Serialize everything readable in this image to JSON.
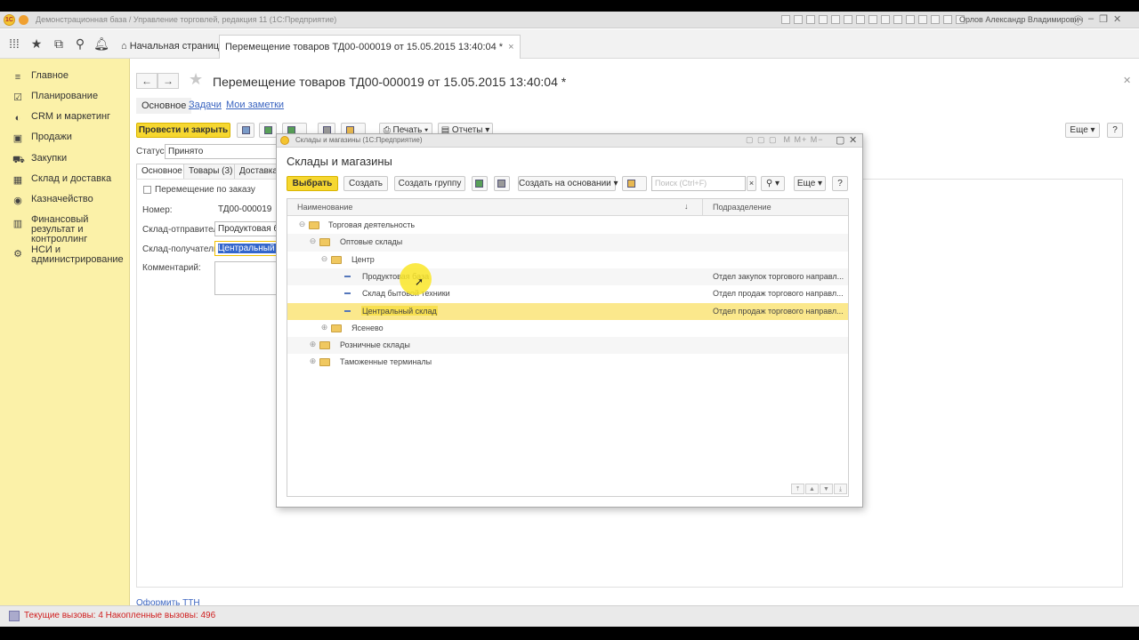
{
  "window": {
    "title": "Демонстрационная база / Управление торговлей, редакция 11 (1С:Предприятие)",
    "user": "Орлов Александр Владимирович"
  },
  "tabs": {
    "home": "Начальная страница",
    "doc": "Перемещение товаров ТД00-000019 от 15.05.2015 13:40:04 *",
    "close": "×"
  },
  "sidebar": {
    "items": [
      {
        "label": "Главное",
        "icon": "≡"
      },
      {
        "label": "Планирование",
        "icon": "☑"
      },
      {
        "label": "CRM и маркетинг",
        "icon": "◐"
      },
      {
        "label": "Продажи",
        "icon": "▣"
      },
      {
        "label": "Закупки",
        "icon": "⛟"
      },
      {
        "label": "Склад и доставка",
        "icon": "▦"
      },
      {
        "label": "Казначейство",
        "icon": "◉"
      },
      {
        "label": "Финансовый результат и контроллинг",
        "icon": "▥"
      },
      {
        "label": "НСИ и администрирование",
        "icon": "⚙"
      }
    ]
  },
  "form": {
    "title": "Перемещение товаров ТД00-000019 от 15.05.2015 13:40:04 *",
    "tabs": [
      "Основное",
      "Задачи",
      "Мои заметки"
    ],
    "post_close": "Провести и закрыть",
    "print": "Печать",
    "reports": "Отчеты",
    "more": "Еще",
    "help": "?",
    "status_label": "Статус:",
    "status_value": "Принято",
    "inner_tabs": [
      "Основное",
      "Товары (3)",
      "Доставка"
    ],
    "by_order": "Перемещение по заказу",
    "number_label": "Номер:",
    "number_value": "ТД00-000019",
    "sender_label": "Склад-отправитель:",
    "sender_value": "Продуктовая база",
    "receiver_label": "Склад-получатель:",
    "receiver_value": "Центральный склад",
    "comment_label": "Комментарий:",
    "bottom_link": "Оформить ТТН"
  },
  "status_bar": {
    "text": "Текущие вызовы: 4   Накопленные вызовы: 496"
  },
  "dialog": {
    "window_title": "Склады и магазины (1С:Предприятие)",
    "title": "Склады и магазины",
    "select": "Выбрать",
    "create": "Создать",
    "create_group": "Создать группу",
    "create_based": "Создать на основании",
    "search_placeholder": "Поиск (Ctrl+F)",
    "more": "Еще",
    "help": "?",
    "col_name": "Наименование",
    "col_dept": "Подразделение",
    "rows": [
      {
        "name": "Торговая деятельность",
        "dept": ""
      },
      {
        "name": "Оптовые склады",
        "dept": ""
      },
      {
        "name": "Центр",
        "dept": ""
      },
      {
        "name": "Продуктовая база",
        "dept": "Отдел закупок торгового направл..."
      },
      {
        "name": "Склад бытовой техники",
        "dept": "Отдел продаж торгового направл..."
      },
      {
        "name": "Центральный склад",
        "dept": "Отдел продаж торгового направл..."
      },
      {
        "name": "Ясенево",
        "dept": ""
      },
      {
        "name": "Розничные склады",
        "dept": ""
      },
      {
        "name": "Таможенные терминалы",
        "dept": ""
      }
    ]
  }
}
